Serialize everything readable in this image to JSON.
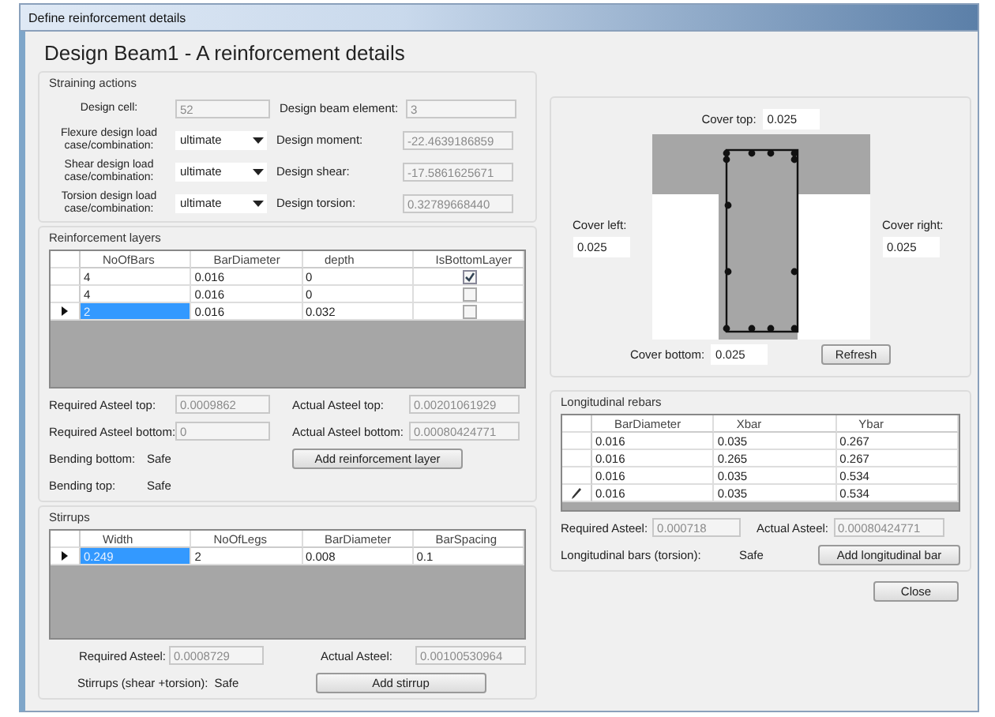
{
  "window": {
    "title": "Define reinforcement details"
  },
  "heading": "Design Beam1 - A reinforcement details",
  "straining_actions": {
    "title": "Straining actions",
    "rows": [
      {
        "label": "Design cell:",
        "kind": "field",
        "value": "52",
        "label_2": "Design beam element:",
        "value_2": "3"
      },
      {
        "label": "Flexure design load case/combination:",
        "kind": "dropdown",
        "value": "ultimate",
        "label_2": "Design moment:",
        "value_2": "-22.4639186859"
      },
      {
        "label": "Shear design load case/combination:",
        "kind": "dropdown",
        "value": "ultimate",
        "label_2": "Design shear:",
        "value_2": "-17.5861625671"
      },
      {
        "label": "Torsion design load case/combination:",
        "kind": "dropdown",
        "value": "ultimate",
        "label_2": "Design torsion:",
        "value_2": "0.32789668440"
      }
    ]
  },
  "reinforcement_layers": {
    "title": "Reinforcement layers",
    "columns": [
      "NoOfBars",
      "BarDiameter",
      "depth",
      "IsBottomLayer"
    ],
    "rows": [
      {
        "cells": [
          "4",
          "0.016",
          "0"
        ],
        "checked": true,
        "selected": false
      },
      {
        "cells": [
          "4",
          "0.016",
          "0"
        ],
        "checked": false,
        "selected": false
      },
      {
        "cells": [
          "2",
          "0.016",
          "0.032"
        ],
        "checked": false,
        "selected": true
      }
    ],
    "required_top": {
      "label": "Required Asteel top:",
      "value": "0.0009862"
    },
    "actual_top": {
      "label": "Actual Asteel top:",
      "value": "0.00201061929"
    },
    "required_bottom": {
      "label": "Required Asteel bottom:",
      "value": "0"
    },
    "actual_bottom": {
      "label": "Actual Asteel bottom:",
      "value": "0.00080424771"
    },
    "bending_bottom": {
      "label": "Bending bottom:",
      "value": "Safe"
    },
    "bending_top": {
      "label": "Bending top:",
      "value": "Safe"
    },
    "add_button": "Add reinforcement layer"
  },
  "stirrups": {
    "title": "Stirrups",
    "columns": [
      "Width",
      "NoOfLegs",
      "BarDiameter",
      "BarSpacing"
    ],
    "rows": [
      {
        "cells": [
          "0.249",
          "2",
          "0.008",
          "0.1"
        ],
        "selected": true
      }
    ],
    "required": {
      "label": "Required Asteel:",
      "value": "0.0008729"
    },
    "actual": {
      "label": "Actual Asteel:",
      "value": "0.00100530964"
    },
    "status": {
      "label": "Stirrups (shear +torsion):",
      "value": "Safe"
    },
    "add_button": "Add stirrup"
  },
  "section": {
    "cover_top": {
      "label": "Cover top:",
      "value": "0.025"
    },
    "cover_left": {
      "label": "Cover left:",
      "value": "0.025"
    },
    "cover_right": {
      "label": "Cover right:",
      "value": "0.025"
    },
    "cover_bottom": {
      "label": "Cover bottom:",
      "value": "0.025"
    },
    "refresh_button": "Refresh"
  },
  "longitudinal_rebars": {
    "title": "Longitudinal rebars",
    "columns": [
      "BarDiameter",
      "Xbar",
      "Ybar"
    ],
    "rows": [
      {
        "cells": [
          "0.016",
          "0.035",
          "0.267"
        ],
        "editing": false
      },
      {
        "cells": [
          "0.016",
          "0.265",
          "0.267"
        ],
        "editing": false
      },
      {
        "cells": [
          "0.016",
          "0.035",
          "0.534"
        ],
        "editing": false
      },
      {
        "cells": [
          "0.016",
          "0.035",
          "0.534"
        ],
        "editing": true
      }
    ],
    "required": {
      "label": "Required Asteel:",
      "value": "0.000718"
    },
    "actual": {
      "label": "Actual Asteel:",
      "value": "0.00080424771"
    },
    "status": {
      "label": "Longitudinal bars (torsion):",
      "value": "Safe"
    },
    "add_button": "Add longitudinal bar"
  },
  "close_button": "Close"
}
